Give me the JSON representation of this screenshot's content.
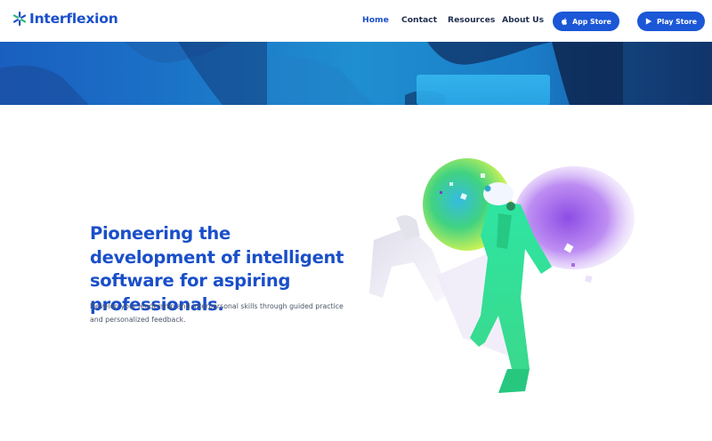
{
  "brand": {
    "name": "Interflexion",
    "primary_color": "#1a4fc9",
    "button_color": "#1b57d6",
    "logo_icon": "asterisk-logo-icon"
  },
  "nav": {
    "items": [
      {
        "label": "Home",
        "active": true
      },
      {
        "label": "Contact",
        "active": false
      },
      {
        "label": "Resources",
        "active": false
      },
      {
        "label": "About Us",
        "active": false
      }
    ],
    "app_store": {
      "label": "App Store",
      "icon": "apple-icon"
    },
    "play_store": {
      "label": "Play Store",
      "icon": "play-icon"
    }
  },
  "hero": {
    "title": "Pioneering the development of intelligent software for aspiring professionals.",
    "subtitle": "Develop your leadership and interpersonal skills through guided practice and personalized feedback.",
    "illustration": "walking-figure-illustration"
  }
}
